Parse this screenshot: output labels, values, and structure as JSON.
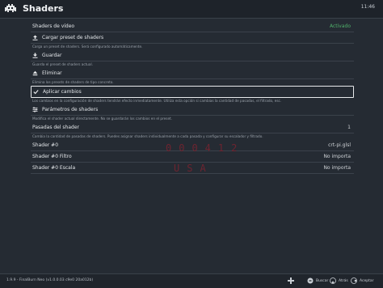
{
  "header": {
    "title": "Shaders",
    "clock": "11:46"
  },
  "items": {
    "video_shaders": {
      "label": "Shaders de vídeo",
      "value": "Activado"
    },
    "load_preset": {
      "label": "Cargar preset de shaders",
      "desc": "Carga un preset de shaders. Será configurado automáticamente."
    },
    "save": {
      "label": "Guardar",
      "desc": "Guarda el preset de shaders actual."
    },
    "remove": {
      "label": "Eliminar",
      "desc": "Elimina los presets de shaders de tipo concreto."
    },
    "apply": {
      "label": "Aplicar cambios",
      "desc": "Los cambios en la configuración de shaders tendrán efecto inmediatamente. Utiliza esta opción si cambias la cantidad de pasadas, el filtrado, esc."
    },
    "params": {
      "label": "Parámetros de shaders",
      "desc": "Modifica el shader actual directamente. No se guardarán los cambios en el preset."
    },
    "passes": {
      "label": "Pasadas del shader",
      "value": "1",
      "desc": "Cambia la cantidad de pasadas de shaders. Puedes asignar shaders individualmente a cada pasada y configurar su escalador y filtrado."
    },
    "shader0": {
      "label": "Shader #0",
      "value": "crt-pi.glsl"
    },
    "shader0_filter": {
      "label": "Shader #0 Filtro",
      "value": "No importa"
    },
    "shader0_scale": {
      "label": "Shader #0 Escala",
      "value": "No importa"
    }
  },
  "overlay": {
    "line1": "000412",
    "line2": "USA"
  },
  "footer": {
    "version": "1.9.9 - FinalBurn Neo (v1.0.0.03 c9e0 20a012b)",
    "hints": [
      {
        "icon": "dpad-icon",
        "label": ""
      },
      {
        "icon": "select-icon",
        "label": "Buscar"
      },
      {
        "icon": "b-button-icon",
        "label": "Atrás"
      },
      {
        "icon": "a-button-icon",
        "label": "Aceptar"
      }
    ]
  },
  "colors": {
    "background": "#252b33",
    "accent": "#4fb06a",
    "overlay": "#7a2330"
  }
}
